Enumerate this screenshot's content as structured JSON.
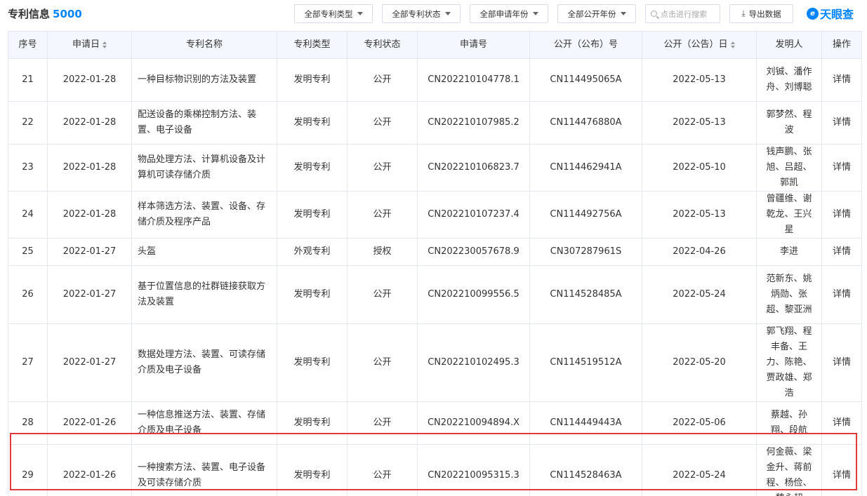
{
  "header": {
    "title": "专利信息",
    "count": "5000",
    "filters": [
      "全部专利类型",
      "全部专利状态",
      "全部申请年份",
      "全部公开年份"
    ],
    "search_placeholder": "点击进行搜索",
    "export_label": "导出数据",
    "logo_text": "天眼查"
  },
  "table": {
    "columns": [
      "序号",
      "申请日",
      "专利名称",
      "专利类型",
      "专利状态",
      "申请号",
      "公开（公布）号",
      "公开（公告）日",
      "发明人",
      "操作"
    ],
    "rows": [
      {
        "no": "21",
        "date": "2022-01-28",
        "name": "一种目标物识别的方法及装置",
        "type": "发明专利",
        "status": "公开",
        "app_no": "CN202210104778.1",
        "pub_no": "CN114495065A",
        "pub_date": "2022-05-13",
        "inventors": "刘铖、潘作舟、刘博聪",
        "action": "详情"
      },
      {
        "no": "22",
        "date": "2022-01-28",
        "name": "配送设备的乘梯控制方法、装置、电子设备",
        "type": "发明专利",
        "status": "公开",
        "app_no": "CN202210107985.2",
        "pub_no": "CN114476880A",
        "pub_date": "2022-05-13",
        "inventors": "郭梦然、程波",
        "action": "详情"
      },
      {
        "no": "23",
        "date": "2022-01-28",
        "name": "物品处理方法、计算机设备及计算机可读存储介质",
        "type": "发明专利",
        "status": "公开",
        "app_no": "CN202210106823.7",
        "pub_no": "CN114462941A",
        "pub_date": "2022-05-10",
        "inventors": "钱声鹏、张旭、吕超、郭凯",
        "action": "详情"
      },
      {
        "no": "24",
        "date": "2022-01-28",
        "name": "样本筛选方法、装置、设备、存储介质及程序产品",
        "type": "发明专利",
        "status": "公开",
        "app_no": "CN202210107237.4",
        "pub_no": "CN114492756A",
        "pub_date": "2022-05-13",
        "inventors": "曾疆维、谢乾龙、王兴星",
        "action": "详情"
      },
      {
        "no": "25",
        "date": "2022-01-27",
        "name": "头盔",
        "type": "外观专利",
        "status": "授权",
        "app_no": "CN202230057678.9",
        "pub_no": "CN307287961S",
        "pub_date": "2022-04-26",
        "inventors": "李进",
        "action": "详情"
      },
      {
        "no": "26",
        "date": "2022-01-27",
        "name": "基于位置信息的社群链接获取方法及装置",
        "type": "发明专利",
        "status": "公开",
        "app_no": "CN202210099556.5",
        "pub_no": "CN114528485A",
        "pub_date": "2022-05-24",
        "inventors": "范新东、姚炳勋、张超、黎亚洲",
        "action": "详情"
      },
      {
        "no": "27",
        "date": "2022-01-27",
        "name": "数据处理方法、装置、可读存储介质及电子设备",
        "type": "发明专利",
        "status": "公开",
        "app_no": "CN202210102495.3",
        "pub_no": "CN114519512A",
        "pub_date": "2022-05-20",
        "inventors": "郭飞翔、程丰备、王力、陈艳、贾政雄、郑浩",
        "action": "详情"
      },
      {
        "no": "28",
        "date": "2022-01-26",
        "name": "一种信息推送方法、装置、存储介质及电子设备",
        "type": "发明专利",
        "status": "公开",
        "app_no": "CN202210094894.X",
        "pub_no": "CN114449443A",
        "pub_date": "2022-05-06",
        "inventors": "蔡越、孙翔、段航",
        "action": "详情"
      },
      {
        "no": "29",
        "date": "2022-01-26",
        "name": "一种搜索方法、装置、电子设备及可读存储介质",
        "type": "发明专利",
        "status": "公开",
        "app_no": "CN202210095315.3",
        "pub_no": "CN114528463A",
        "pub_date": "2022-05-24",
        "inventors": "何金薇、梁金升、蒋前程、杨俭、魏永超",
        "action": "详情"
      }
    ]
  },
  "colors": {
    "accent": "#0084ff",
    "status_open": "#a052c8",
    "status_granted": "#2b9e3e",
    "highlight": "#e23a3a",
    "header_bg": "#f4f7fd"
  }
}
